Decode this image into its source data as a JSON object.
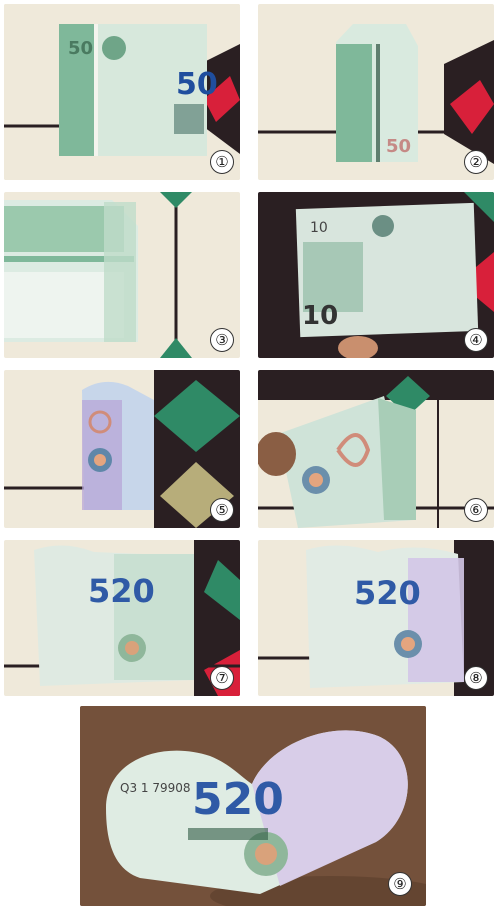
{
  "steps": [
    {
      "label": "①"
    },
    {
      "label": "②"
    },
    {
      "label": "③"
    },
    {
      "label": "④"
    },
    {
      "label": "⑤"
    },
    {
      "label": "⑥"
    },
    {
      "label": "⑦"
    },
    {
      "label": "⑧"
    },
    {
      "label": "⑨"
    }
  ],
  "banknote_text": {
    "value_50": "50",
    "value_10": "10",
    "heart_number": "520",
    "serial": "Q3 1 79908"
  },
  "colors": {
    "floor_cream": "#e8e0cf",
    "tile_black": "#2a1f22",
    "tile_red": "#d8203a",
    "tile_green": "#2f8a66",
    "tile_khaki": "#b7ad7a",
    "note_green": "#7fb89a",
    "note_purple": "#b7a3d6",
    "table_brown": "#6b4a35"
  }
}
